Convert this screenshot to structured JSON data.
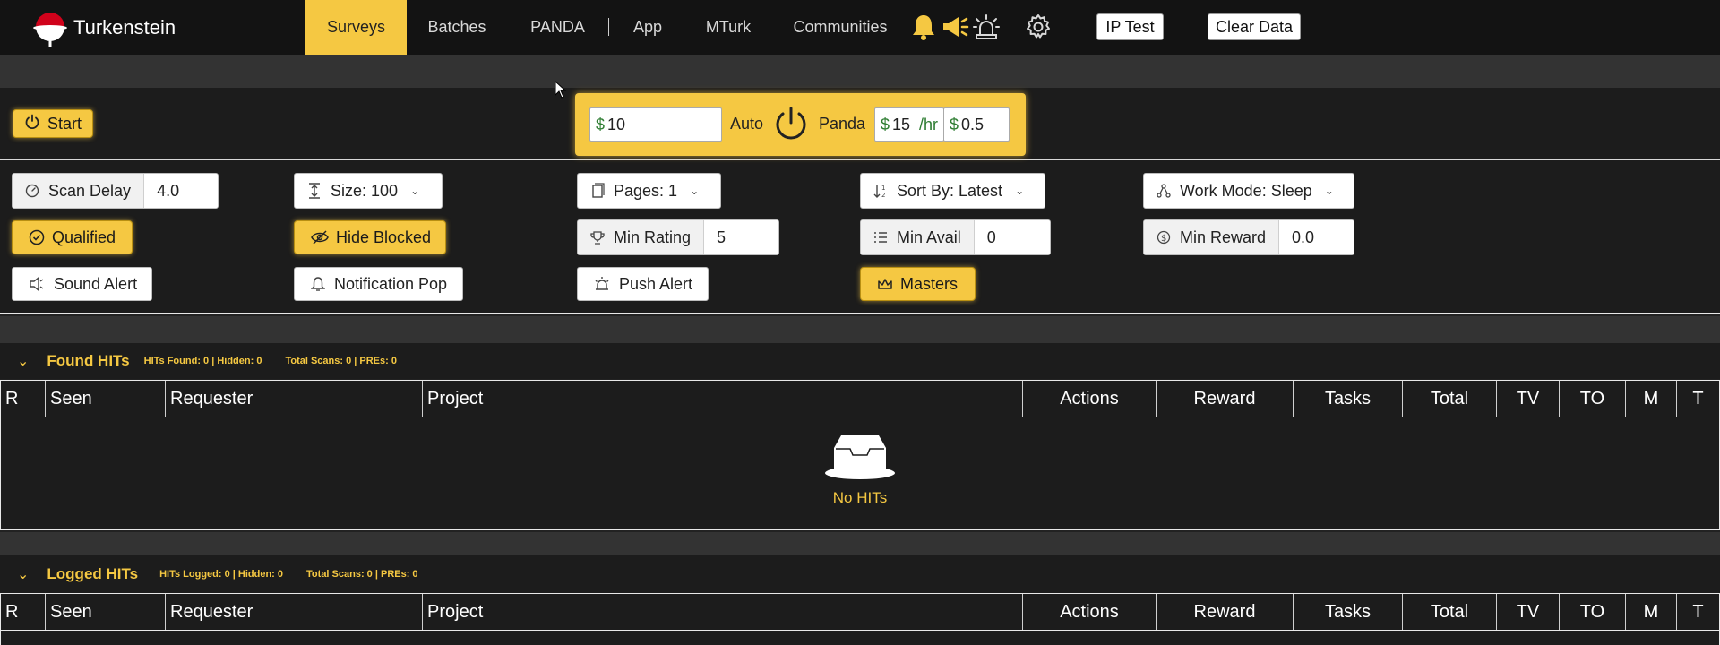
{
  "app": {
    "name": "Turkenstein"
  },
  "nav": {
    "items": [
      "Surveys",
      "Batches",
      "PANDA",
      "App",
      "MTurk",
      "Communities"
    ],
    "active": "Surveys",
    "ip_test_label": "IP Test",
    "clear_data_label": "Clear Data"
  },
  "icons": [
    "bell-icon",
    "megaphone-icon",
    "siren-icon",
    "gear-icon"
  ],
  "controls": {
    "start_label": "Start",
    "panda": {
      "amount": "10",
      "auto_label": "Auto",
      "panda_label": "Panda",
      "rate": "15",
      "rate_unit": "/hr",
      "min": "0.5",
      "currency": "$"
    },
    "scan_delay": {
      "label": "Scan Delay",
      "value": "4.0"
    },
    "size": {
      "label": "Size: 100"
    },
    "pages": {
      "label": "Pages: 1"
    },
    "sort_by": {
      "label": "Sort By: Latest"
    },
    "work_mode": {
      "label": "Work Mode: Sleep"
    },
    "qualified_label": "Qualified",
    "hide_blocked_label": "Hide Blocked",
    "min_rating": {
      "label": "Min Rating",
      "value": "5"
    },
    "min_avail": {
      "label": "Min Avail",
      "value": "0"
    },
    "min_reward": {
      "label": "Min Reward",
      "value": "0.0"
    },
    "sound_alert_label": "Sound Alert",
    "notification_pop_label": "Notification Pop",
    "push_alert_label": "Push Alert",
    "masters_label": "Masters"
  },
  "found": {
    "title": "Found HITs",
    "stats": "HITs Found: 0 | Hidden: 0",
    "scans": "Total Scans: 0 | PREs: 0",
    "empty": "No HITs"
  },
  "logged": {
    "title": "Logged HITs",
    "stats": "HITs Logged: 0 | Hidden: 0",
    "scans": "Total Scans: 0 | PREs: 0"
  },
  "table": {
    "columns": [
      "R",
      "Seen",
      "Requester",
      "Project",
      "Actions",
      "Reward",
      "Tasks",
      "Total",
      "TV",
      "TO",
      "M",
      "T"
    ]
  },
  "colors": {
    "accent": "#f5c842",
    "nav_bg": "#131313",
    "page_bg": "#222222",
    "panel_bg": "#1c1c1c",
    "logo_red": "#d0021b"
  }
}
